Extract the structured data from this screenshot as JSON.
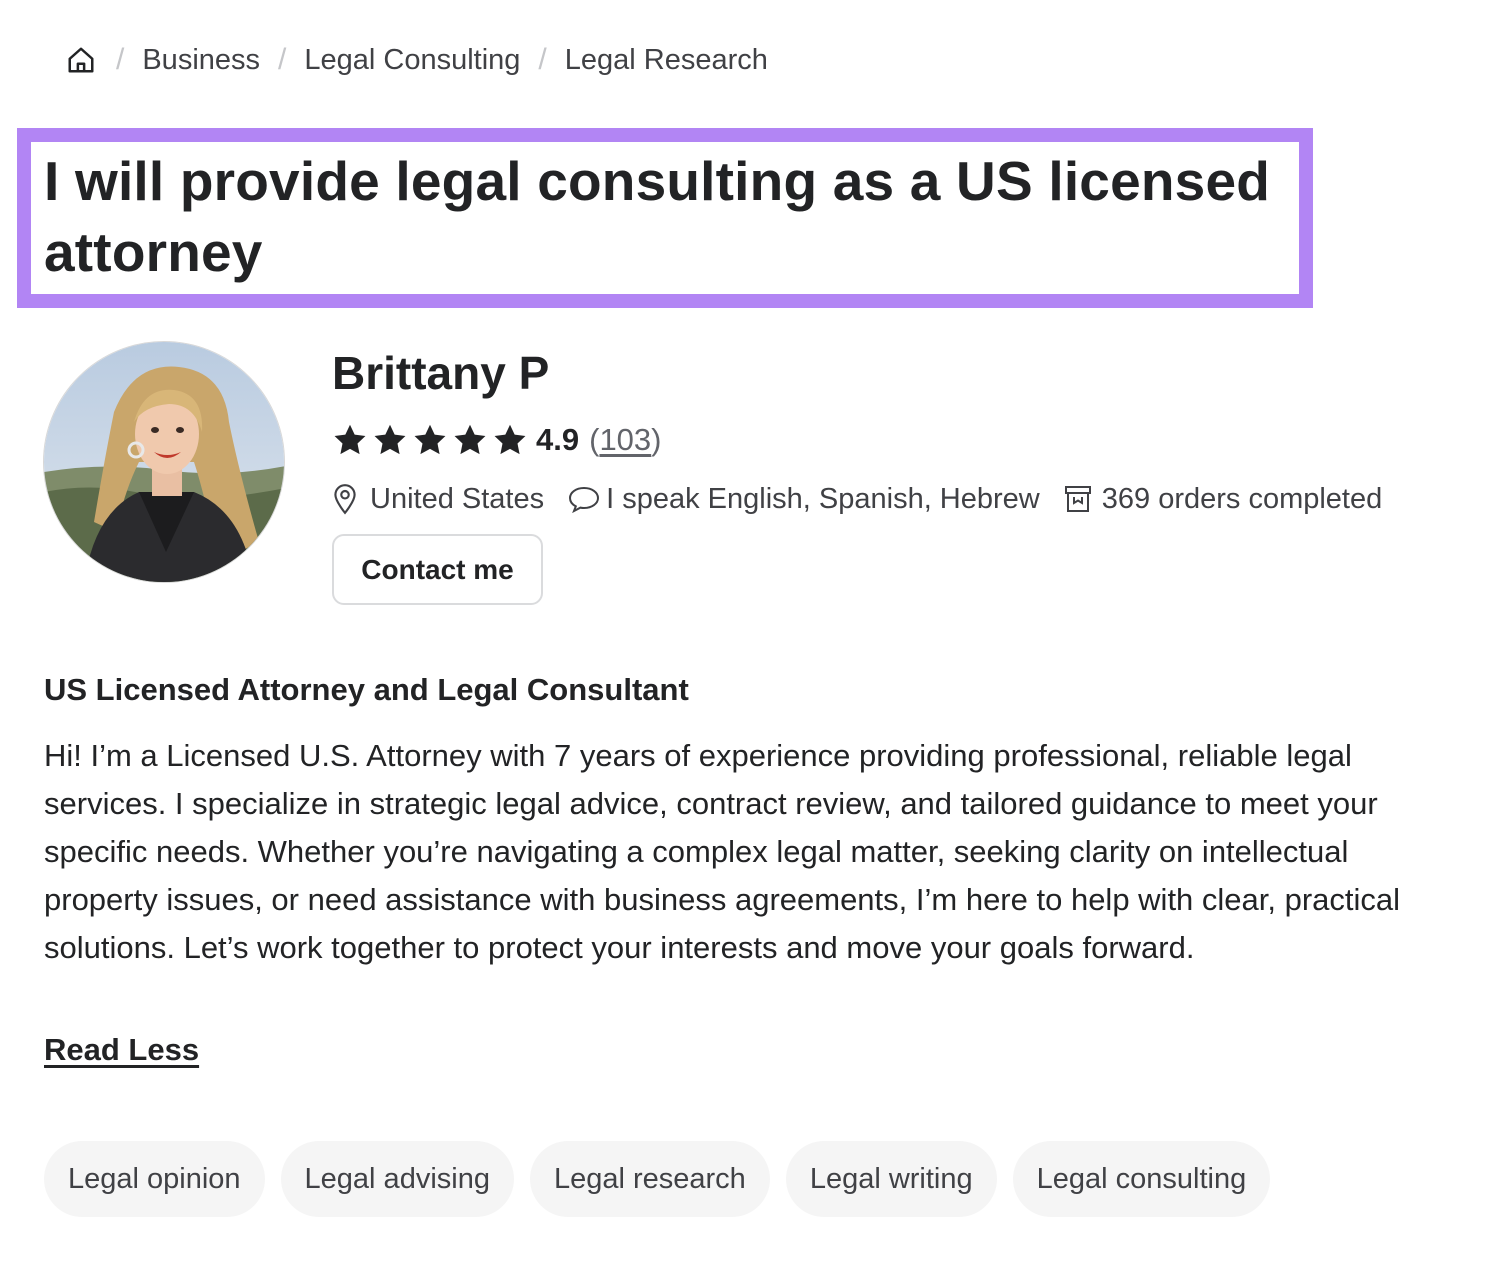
{
  "breadcrumb": {
    "home_icon": "home-icon",
    "items": [
      "Business",
      "Legal Consulting",
      "Legal Research"
    ]
  },
  "gig": {
    "title": "I will provide legal consulting as a US licensed attorney",
    "highlight_color": "#b285f4"
  },
  "seller": {
    "name": "Brittany P",
    "rating_score": "4.9",
    "review_count": "103",
    "stars": 5,
    "location": "United States",
    "languages": "I speak English, Spanish, Hebrew",
    "orders": "369 orders completed",
    "contact_label": "Contact me"
  },
  "about": {
    "heading": "US Licensed Attorney and Legal Consultant",
    "body": "Hi! I’m a Licensed U.S. Attorney with 7 years of experience providing professional, reliable legal services. I specialize in strategic legal advice, contract review, and tailored guidance to meet your specific needs. Whether you’re navigating a complex legal matter, seeking clarity on intellectual property issues, or need assistance with business agreements, I’m here to help with clear, practical solutions. Let’s work together to protect your interests and move your goals forward.",
    "read_less": "Read Less"
  },
  "tags": [
    "Legal opinion",
    "Legal advising",
    "Legal research",
    "Legal writing",
    "Legal consulting"
  ]
}
